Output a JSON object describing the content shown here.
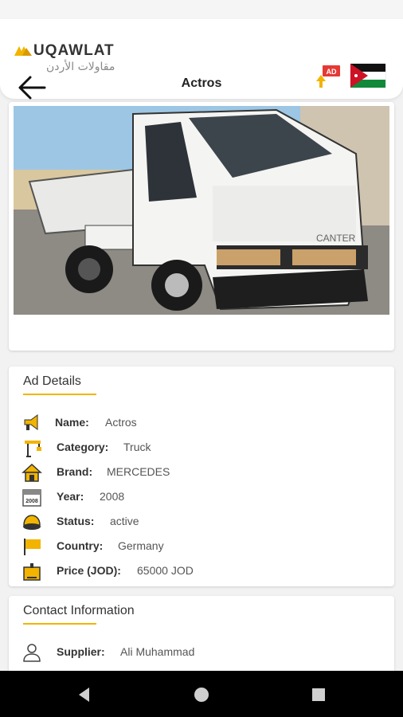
{
  "brand": {
    "logo_en": "UQAWLAT",
    "logo_ar": "مقاولات الأردن",
    "ad_badge": "AD"
  },
  "header": {
    "title": "Actros"
  },
  "details": {
    "title": "Ad Details",
    "rows": [
      {
        "label": "Name:",
        "value": "Actros",
        "icon": "megaphone-icon"
      },
      {
        "label": "Category:",
        "value": "Truck",
        "icon": "crane-icon"
      },
      {
        "label": "Brand:",
        "value": "MERCEDES",
        "icon": "house-icon"
      },
      {
        "label": "Year:",
        "value": "2008",
        "icon": "calendar-icon"
      },
      {
        "label": "Status:",
        "value": "active",
        "icon": "hard-hat-icon"
      },
      {
        "label": "Country:",
        "value": "Germany",
        "icon": "flag-icon"
      },
      {
        "label": "Price (JOD):",
        "value": "65000 JOD",
        "icon": "price-icon"
      }
    ]
  },
  "contact": {
    "title": "Contact Information",
    "rows": [
      {
        "label": "Supplier:",
        "value": "Ali Muhammad",
        "icon": "person-icon"
      }
    ]
  },
  "photo": {
    "truck_text": "CANTER"
  },
  "calendar": {
    "year": "2008"
  },
  "colors": {
    "accent": "#f2b400",
    "navbar": "#000000"
  }
}
